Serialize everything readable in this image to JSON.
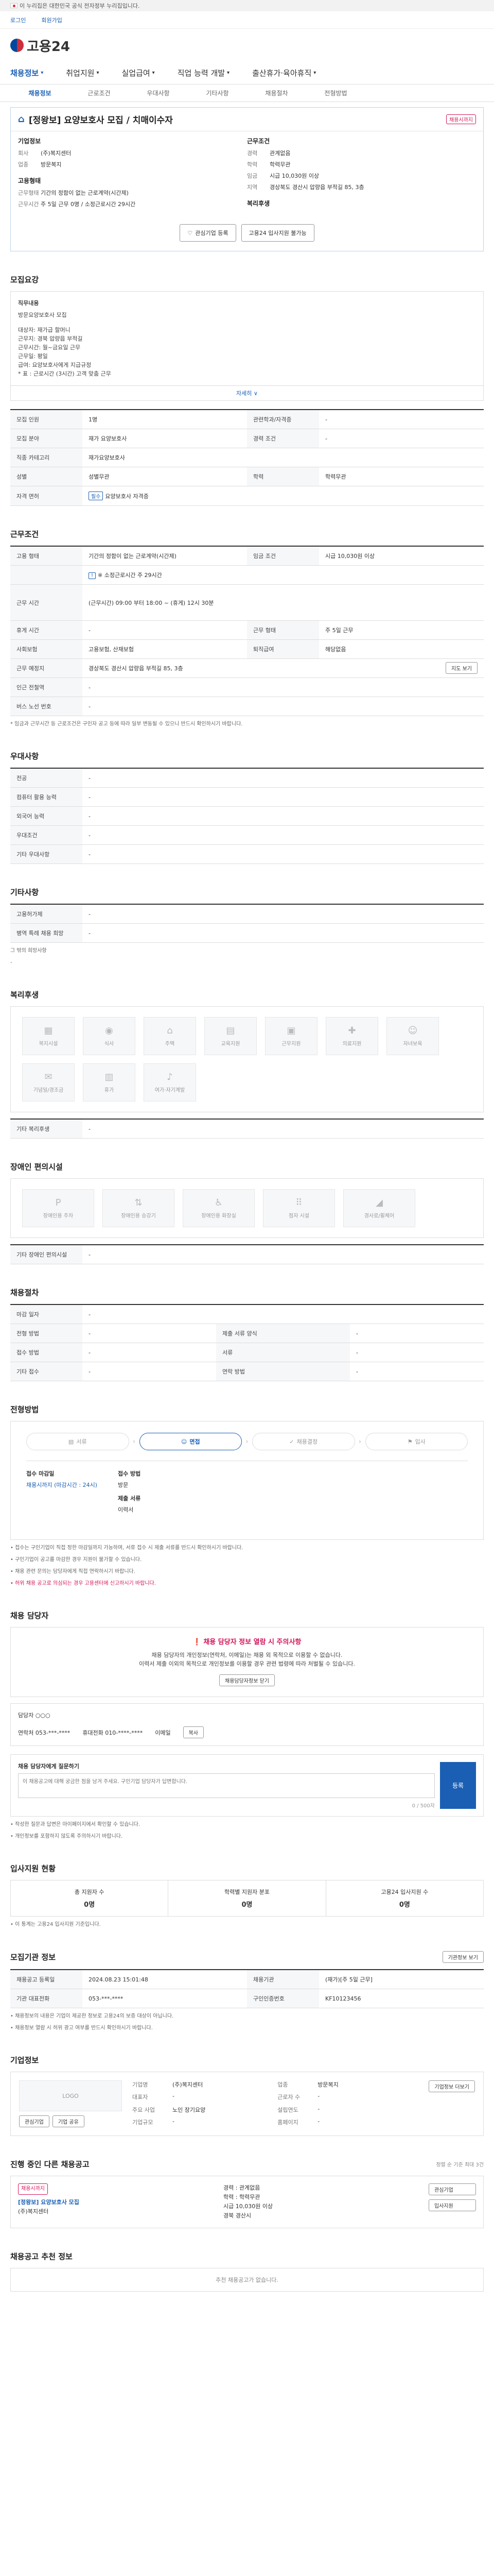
{
  "gov_bar": {
    "text": "이 누리집은 대한민국 공식 전자정부 누리집입니다."
  },
  "topbar": {
    "links": [
      "로그인",
      "회원가입"
    ]
  },
  "logo": {
    "text": "고용24"
  },
  "gnb": [
    {
      "label": "채용정보",
      "on": true
    },
    {
      "label": "취업지원",
      "on": false
    },
    {
      "label": "실업급여",
      "on": false
    },
    {
      "label": "직업 능력 개발",
      "on": false
    },
    {
      "label": "출산휴가·육아휴직",
      "on": false
    }
  ],
  "snb": [
    {
      "label": "채용정보",
      "on": true
    },
    {
      "label": "근로조건",
      "on": false
    },
    {
      "label": "우대사항",
      "on": false
    },
    {
      "label": "기타사항",
      "on": false
    },
    {
      "label": "채용절차",
      "on": false
    },
    {
      "label": "전형방법",
      "on": false
    }
  ],
  "job": {
    "title": "[정왕보] 요양보호사 모집 / 치매이수자",
    "badge": "채용시까지",
    "company_block": "기업정보",
    "company_kv": [
      {
        "k": "회사",
        "v": "(주)복지센터"
      },
      {
        "k": "업종",
        "v": "방문복지"
      }
    ],
    "condition_block": "근무조건",
    "condition_kv": [
      {
        "k": "경력",
        "v": "관계없음"
      },
      {
        "k": "학력",
        "v": "학력무관"
      },
      {
        "k": "임금",
        "v": "시급 10,030원 이상"
      },
      {
        "k": "지역",
        "v": "경상북도 경산시 압량읍 부적길 85, 3층"
      }
    ],
    "recruit_block": "고용형태",
    "recruit_kv": [
      {
        "k": "근무형태",
        "v": "기간의 정함이 없는 근로계약(시간제)"
      },
      {
        "k": "근무시간",
        "v": "주 5일 근무 0명 / 소정근로시간 29시간"
      }
    ],
    "welfare_block": "복리후생",
    "btn_interest": "관심기업 등록",
    "btn_scrap": "고용24 입사지원 불가능"
  },
  "s_detail": {
    "title": "모집요강",
    "desc_head": "직무내용",
    "desc_lines": [
      "방문요양보호사 모집",
      "",
      "대상자: 재가급 할머니",
      "근무지: 경북 압량읍 부적길",
      "근무시간: 월~금요일 근무",
      "근무일: 평일",
      "급여: 요양보호사에게 지급규정",
      "* 표 : 근로시간 (3시간) 고객 맞춤 근무"
    ],
    "more": "자세히 ∨",
    "rows": [
      {
        "k1": "모집 인원",
        "v1": "1명",
        "k2": "관련학과/자격증",
        "v2": "-"
      },
      {
        "k1": "모집 분야",
        "v1": "재가 요양보호사",
        "k2": "경력 조건",
        "v2": "-"
      },
      {
        "k1": "직종 카테고리",
        "v1": "재가요양보호사",
        "k2": "",
        "v2": ""
      },
      {
        "k1": "성별",
        "v1": "성별무관",
        "k2": "학력",
        "v2": "학력무관"
      },
      {
        "k1": "자격 면허",
        "v1": "요양보호사 자격증",
        "k2": "",
        "v2": ""
      }
    ],
    "chip": "필수"
  },
  "s_cond": {
    "title": "근무조건",
    "rows": [
      {
        "k1": "고용 형태",
        "v1": "기간의 정함이 없는 근로계약(시간제)",
        "k2": "임금 조건",
        "v2": "시급 10,030원 이상"
      },
      {
        "k1": "",
        "v1": "",
        "k2": "",
        "v2": ""
      },
      {
        "k1": "근무 시간",
        "v1": "(근무시간) 09:00 부터 18:00 ~ (휴게) 12시 30분",
        "k2": "",
        "v2": ""
      },
      {
        "k1": "",
        "v1": "",
        "k2": "",
        "v2": ""
      },
      {
        "k1": "휴게 시간",
        "v1": "-",
        "k2": "근무 형태",
        "v2": "주 5일 근무"
      },
      {
        "k1": "사회보험",
        "v1": "고용보험, 산재보험",
        "k2": "퇴직급여",
        "v2": "해당없음"
      },
      {
        "k1": "근무 예정지",
        "v1": "경상북도 경산시 압량읍 부적길 85, 3층",
        "k2": "",
        "v2": ""
      },
      {
        "k1": "인근 전철역",
        "v1": "-",
        "k2": "",
        "v2": ""
      },
      {
        "k1": "버스 노선 번호",
        "v1": "-",
        "k2": "",
        "v2": ""
      }
    ],
    "sub_label": "※ 소정근로시간 주 29시간",
    "map_btn": "지도 보기",
    "note": "* 임금과 근무시간 등 근로조건은 구인자 공고 등에 따라 일부 변동될 수 있으니 반드시 확인하시기 바랍니다."
  },
  "s_pref": {
    "title": "우대사항",
    "rows": [
      {
        "k": "전공",
        "v": "-"
      },
      {
        "k": "컴퓨터 활용 능력",
        "v": "-"
      },
      {
        "k": "외국어 능력",
        "v": "-"
      },
      {
        "k": "우대조건",
        "v": "-"
      },
      {
        "k": "기타 우대사항",
        "v": "-"
      }
    ]
  },
  "s_etc": {
    "title": "기타사항",
    "rows": [
      {
        "k": "고용허가제",
        "v": "-"
      },
      {
        "k": "병역 특례 채용 희망",
        "v": "-"
      }
    ],
    "question_label": "그 밖의 희망사항",
    "question_val": "-"
  },
  "s_welfare": {
    "title": "복리후생",
    "items": [
      "복지시설",
      "식사",
      "주택",
      "교육지원",
      "근무지원",
      "의료지원",
      "자녀보육",
      "기념일/경조금",
      "휴가",
      "여가·자기계발"
    ],
    "note_label": "기타 복리후생",
    "note_val": "-"
  },
  "s_disab": {
    "title": "장애인 편의시설",
    "items": [
      "장애인용 주차",
      "장애인용 승강기",
      "장애인용 화장실",
      "점자 시설",
      "경사로/휠체어"
    ],
    "note_label": "기타 장애인 편의시설",
    "note_val": "-"
  },
  "s_process": {
    "title": "채용절차",
    "rows": [
      {
        "k1": "마감 일자",
        "v1": "-",
        "k2": "",
        "v2": ""
      },
      {
        "k1": "전형 방법",
        "v1": "-",
        "k2": "제출 서류 양식",
        "v2": "-"
      },
      {
        "k1": "접수 방법",
        "v1": "-",
        "k2": "서류",
        "v2": "-"
      },
      {
        "k1": "기타 접수",
        "v1": "-",
        "k2": "연락 방법",
        "v2": "-"
      }
    ]
  },
  "s_select": {
    "title": "전형방법",
    "steps": [
      "서류",
      "면접",
      "채용결정",
      "입사"
    ],
    "active": 1,
    "recv": [
      {
        "k": "접수 마감일",
        "v": "채용시까지 (마감시간 : 24시)"
      },
      {
        "k": "접수 방법",
        "v": "방문"
      },
      {
        "k": "제출 서류",
        "v": "이력서"
      }
    ],
    "notes": [
      "• 접수는 구인기업이 직접 정한 마감일까지 가능하며, 서류 접수 시 제출 서류를 반드시 확인하시기 바랍니다.",
      "• 구인기업이 공고를 마감한 경우 지원이 불가할 수 있습니다.",
      "• 채용 관련 문의는 담당자에게 직접 연락하시기 바랍니다."
    ],
    "red_note": "• 허위 채용 공고로 의심되는 경우 고용센터에 신고하시기 바랍니다."
  },
  "s_contact": {
    "title": "채용 담당자",
    "warn_title": "채용 담당자 정보 열람 시 주의사항",
    "warn_lines": [
      "채용 담당자의 개인정보(연락처, 이메일)는 채용 외 목적으로 이용할 수 없습니다.",
      "이력서 제출 이외의 목적으로 개인정보를 이용할 경우 관련 법령에 따라 처벌될 수 있습니다."
    ],
    "warn_btn": "채용담당자정보 닫기",
    "name_label": "담당자",
    "name_val": "○○○",
    "phone_label": "연락처",
    "phone_val": "053-***-****",
    "mobile_label": "휴대전화",
    "mobile_val": "010-****-****",
    "email_label": "이메일",
    "email_btn": "복사"
  },
  "s_inquiry": {
    "title": "채용 담당자에게 질문하기",
    "hint": "이 채용공고에 대해 궁금한 점을 남겨 주세요. 구인기업 담당자가 답변합니다.",
    "counter": "0 / 500자",
    "send": "등록",
    "notes": [
      "• 작성한 질문과 답변은 마이페이지에서 확인할 수 있습니다.",
      "• 개인정보를 포함하지 않도록 주의하시기 바랍니다."
    ]
  },
  "s_stats": {
    "title": "입사지원 현황",
    "items": [
      {
        "k": "총 지원자 수",
        "v": "0명"
      },
      {
        "k": "학력별 지원자 분포",
        "v": "0명"
      },
      {
        "k": "고용24 입사지원 수",
        "v": "0명"
      }
    ],
    "note": "• 이 통계는 고용24 입사지원 기준입니다."
  },
  "s_info": {
    "title": "모집기관 정보",
    "btn": "기관정보 보기",
    "rows": [
      {
        "k1": "채용공고 등록일",
        "v1": "2024.08.23 15:01:48",
        "k2": "채용기관",
        "v2": "(재가)[주 5일 근무]"
      },
      {
        "k1": "기관 대표전화",
        "v1": "053-***-****",
        "k2": "구인인증번호",
        "v2": "KF10123456"
      }
    ],
    "notes": [
      "• 채용정보의 내용은 기업이 제공한 정보로 고용24의 보증 대상이 아닙니다.",
      "• 채용정보 열람 시 허위 광고 여부를 반드시 확인하시기 바랍니다."
    ]
  },
  "s_company": {
    "title": "기업정보",
    "logo_ph": "LOGO",
    "btns": [
      "관심기업",
      "기업 공유"
    ],
    "kv": [
      {
        "k": "기업명",
        "v": "(주)복지센터"
      },
      {
        "k": "업종",
        "v": "방문복지"
      },
      {
        "k": "대표자",
        "v": "-"
      },
      {
        "k": "근로자 수",
        "v": "-"
      },
      {
        "k": "주요 사업",
        "v": "노인 장기요양"
      },
      {
        "k": "설립연도",
        "v": "-"
      },
      {
        "k": "기업규모",
        "v": "-"
      },
      {
        "k": "홈페이지",
        "v": "-"
      }
    ],
    "more": "기업정보 더보기"
  },
  "s_related": {
    "title": "진행 중인 다른 채용공고",
    "sub": "정렬 순 기준 최대 3건",
    "left_label": "채용시까지",
    "left_title": "[정왕보] 요양보호사 모집",
    "left_company": "(주)복지센터",
    "mid_lines": [
      "경력 : 관계없음",
      "학력 : 학력무관",
      "시급 10,030원 이상",
      "경북 경산시"
    ],
    "right_btns": [
      "관심기업",
      "입사지원"
    ]
  },
  "s_near": {
    "title": "채용공고 추천 정보",
    "empty": "추천 채용공고가 없습니다."
  }
}
